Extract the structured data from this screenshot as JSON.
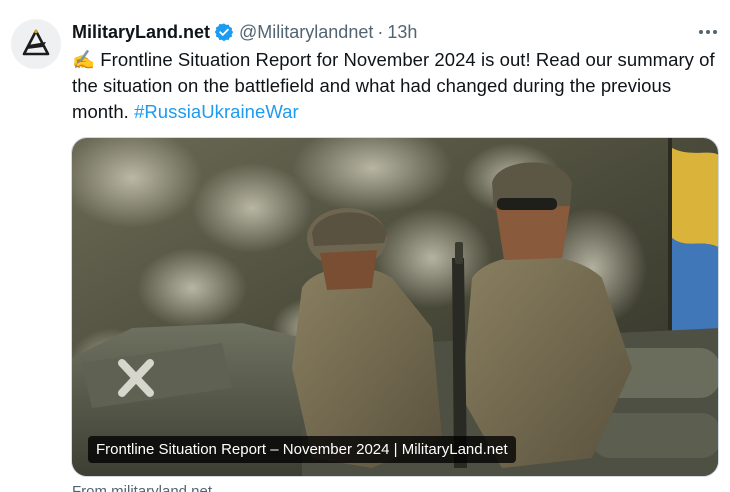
{
  "tweet": {
    "author": {
      "display_name": "MilitaryLand.net",
      "handle": "@Militarylandnet",
      "verified": true,
      "avatar_icon": "militaryland-logo-icon"
    },
    "separator": "·",
    "time": "13h",
    "more_icon": "more-horizontal-icon",
    "text_emoji": "✍️",
    "text_body": "Frontline Situation Report for November 2024 is out! Read our summary of the situation on the battlefield and what had changed during the previous month.",
    "hashtag": "#RussiaUkraineWar",
    "card": {
      "title": "Frontline Situation Report – November 2024 | MilitaryLand.net",
      "source": "From militaryland.net"
    }
  },
  "colors": {
    "text_primary": "#0f1419",
    "text_secondary": "#536471",
    "link": "#1d9bf0",
    "verified_badge": "#1d9bf0"
  }
}
